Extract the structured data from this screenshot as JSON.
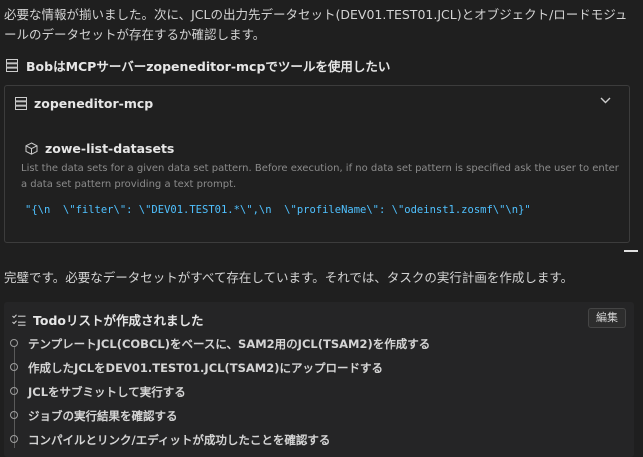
{
  "intro_text": "必要な情報が揃いました。次に、JCLの出力先データセット(DEV01.TEST01.JCL)とオブジェクト/ロードモジュールのデータセットが存在するか確認します。",
  "tool_call": {
    "label": "BobはMCPサーバーzopeneditor-mcpでツールを使用したい",
    "icon": "server-icon"
  },
  "server": {
    "name": "zopeneditor-mcp",
    "expanded": true,
    "tool_name": "zowe-list-datasets",
    "tool_description": "List the data sets for a given data set pattern. Before execution, if no data set pattern is specified ask the user to enter a data set pattern providing a text prompt.",
    "arguments": "\"{\\n  \\\"filter\\\": \\\"DEV01.TEST01.*\\\",\\n  \\\"profileName\\\": \\\"odeinst1.zosmf\\\"\\n}\""
  },
  "summary_text": "完璧です。必要なデータセットがすべて存在しています。それでは、タスクの実行計画を作成します。",
  "todo": {
    "title": "Todoリストが作成されました",
    "edit_label": "編集",
    "items": [
      "テンプレートJCL(COBCL)をベースに、SAM2用のJCL(TSAM2)を作成する",
      "作成したJCLをDEV01.TEST01.JCL(TSAM2)にアップロードする",
      "JCLをサブミットして実行する",
      "ジョブの実行結果を確認する",
      "コンパイルとリンク/エディットが成功したことを確認する"
    ]
  },
  "colors": {
    "background": "#1f1f1f",
    "arguments_text": "#4fc1ff",
    "description_text": "#8b8b8b"
  }
}
